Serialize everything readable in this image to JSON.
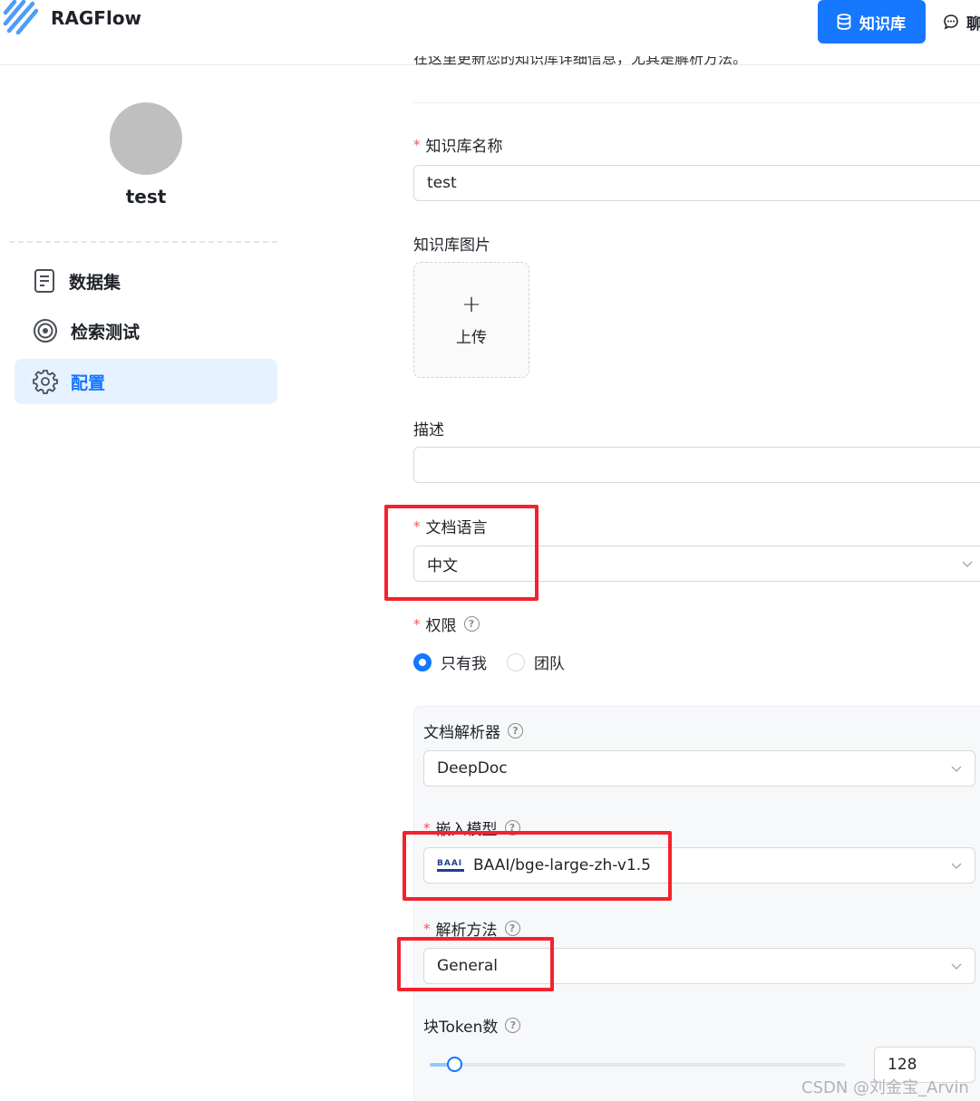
{
  "header": {
    "app_title": "RAGFlow",
    "nav_knowledge_base": "知识库",
    "nav_chat": "聊"
  },
  "sidebar": {
    "kb_name": "test",
    "items": [
      {
        "label": "数据集",
        "icon": "document-icon",
        "active": false
      },
      {
        "label": "检索测试",
        "icon": "target-icon",
        "active": false
      },
      {
        "label": "配置",
        "icon": "gear-icon",
        "active": true
      }
    ]
  },
  "form": {
    "cut_off_text": "在这里更新您的知识库详细信息，尤其是解析方法。",
    "name": {
      "label": "知识库名称",
      "value": "test",
      "required": true
    },
    "image": {
      "label": "知识库图片",
      "upload_label": "上传"
    },
    "description": {
      "label": "描述",
      "value": ""
    },
    "language": {
      "label": "文档语言",
      "value": "中文",
      "required": true
    },
    "permission": {
      "label": "权限",
      "options": [
        "只有我",
        "团队"
      ],
      "selected": "只有我",
      "required": true
    },
    "parser": {
      "label": "文档解析器",
      "value": "DeepDoc"
    },
    "embedding": {
      "label": "嵌入模型",
      "value": "BAAI/bge-large-zh-v1.5",
      "logo_text": "BAAI",
      "required": true
    },
    "chunk_method": {
      "label": "解析方法",
      "value": "General",
      "required": true
    },
    "chunk_tokens": {
      "label": "块Token数",
      "value": "128",
      "slider_fraction": 0.06
    }
  },
  "watermark": "CSDN @刘金宝_Arvin",
  "colors": {
    "accent": "#1677ff",
    "highlight_box": "#f5222d",
    "active_bg": "#e6f2ff"
  }
}
